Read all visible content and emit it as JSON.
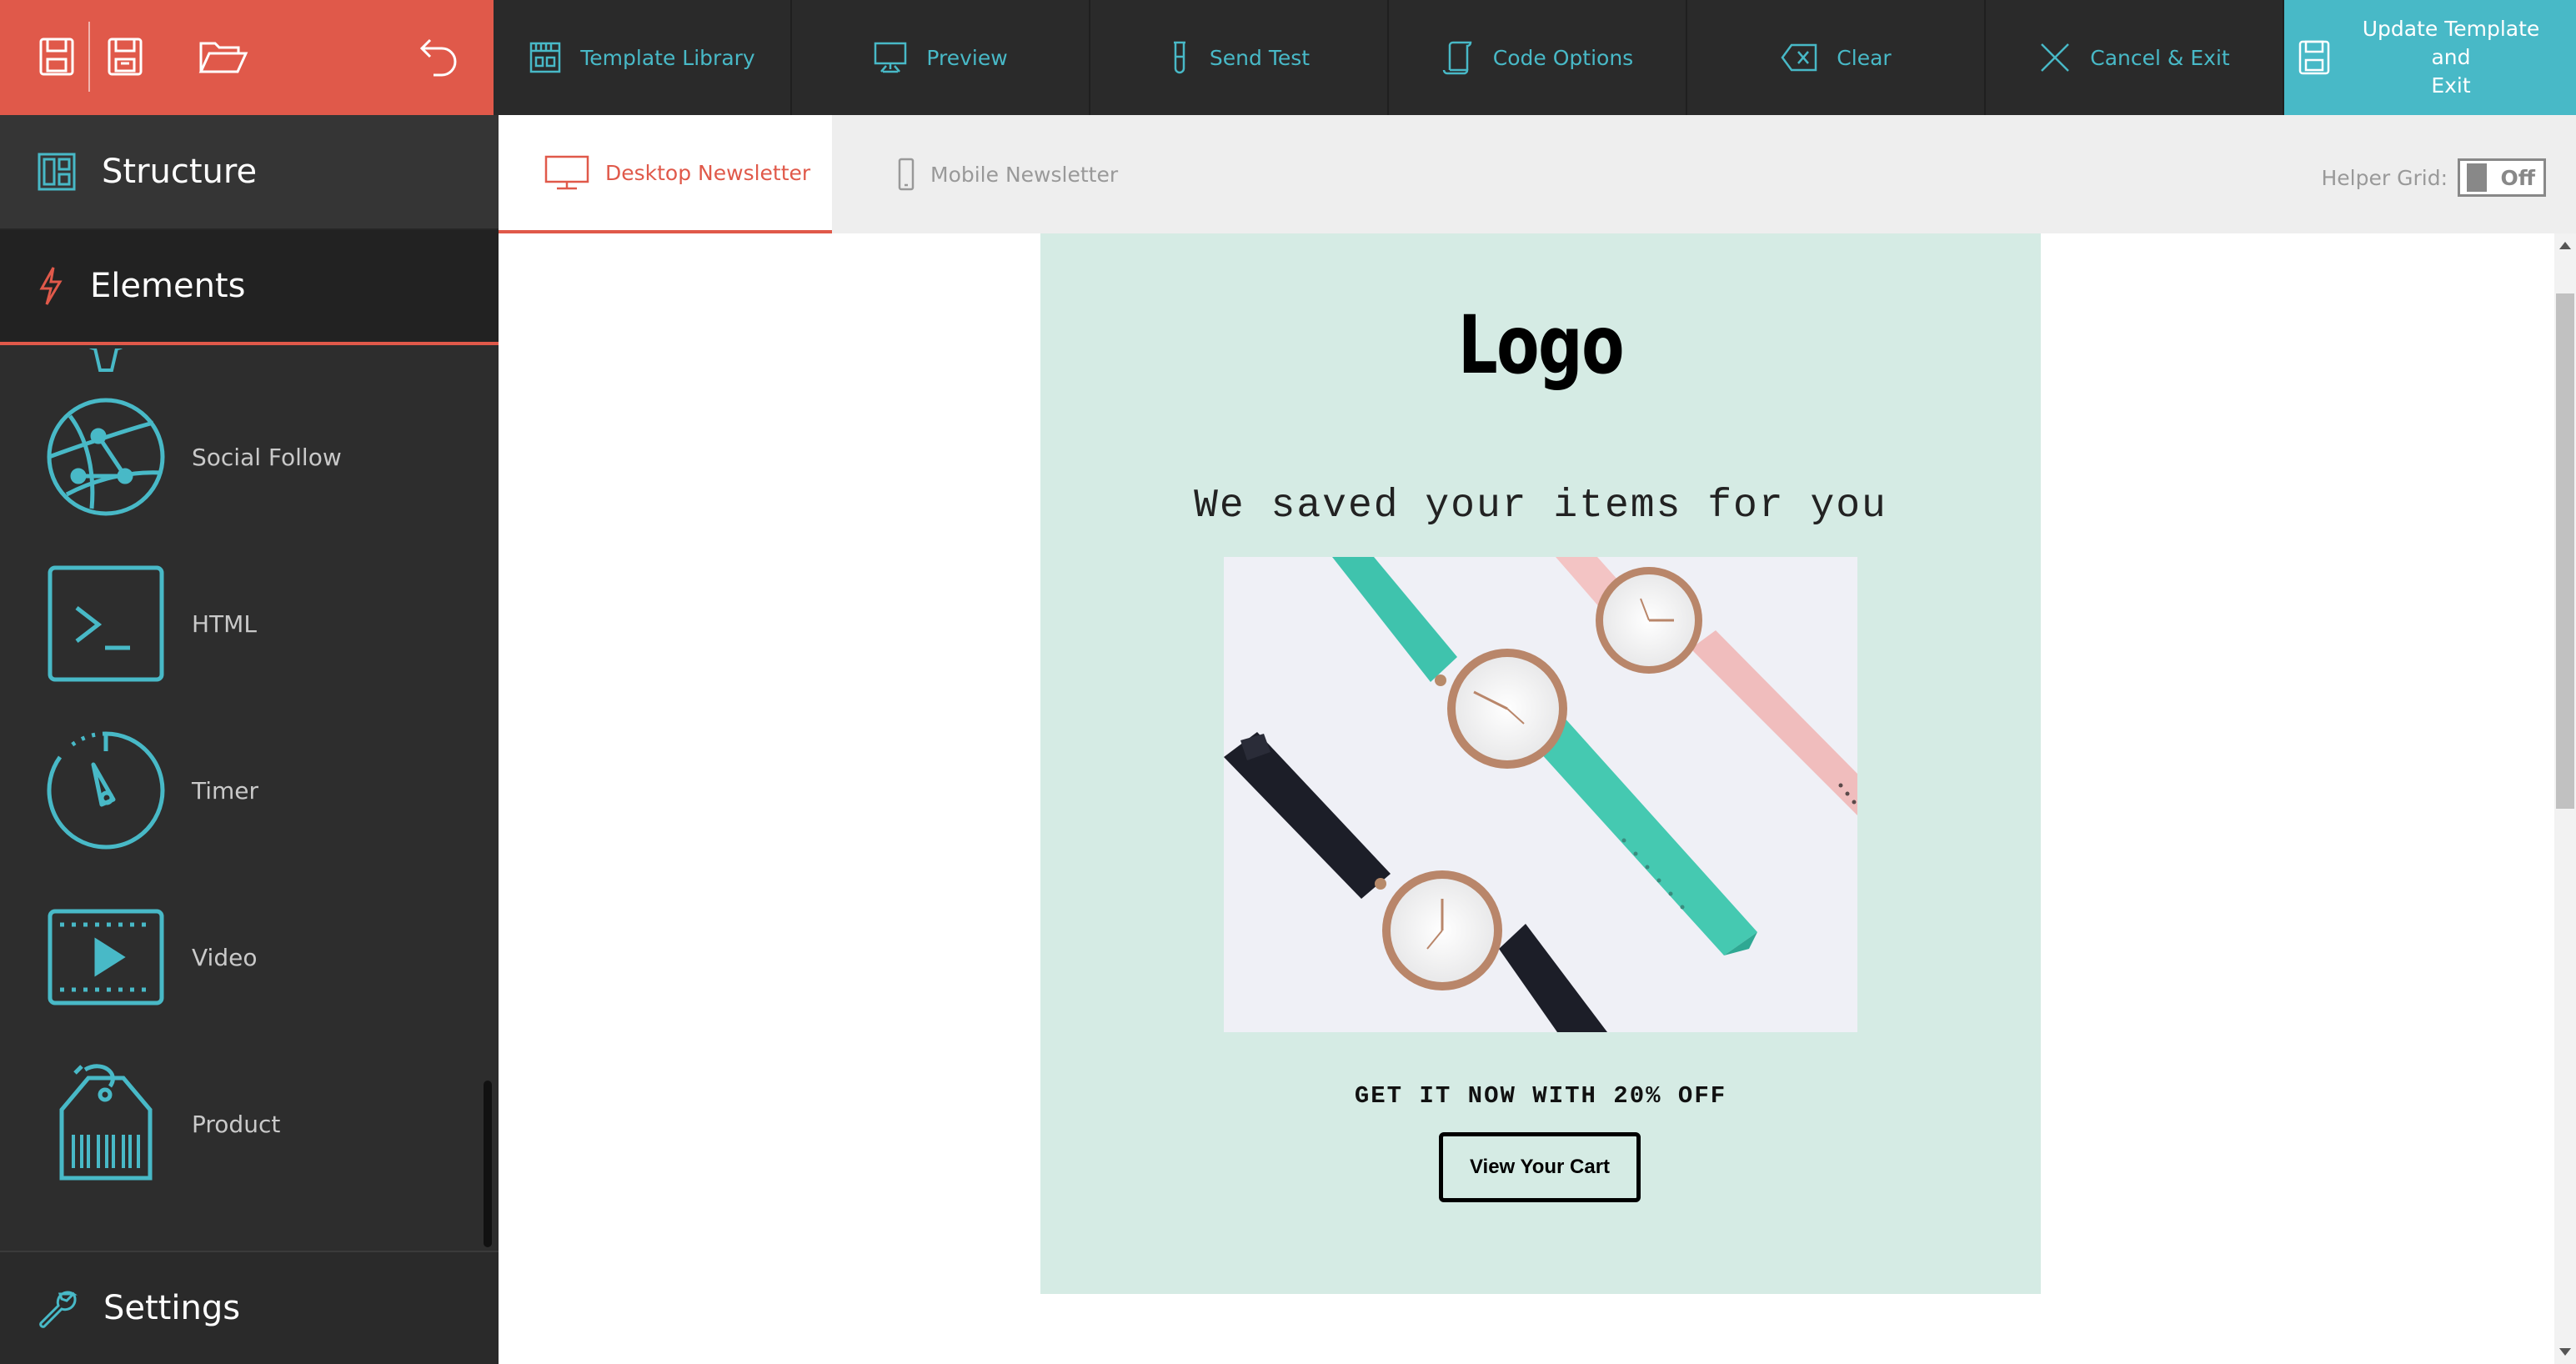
{
  "toolbar": {
    "template_library": "Template Library",
    "preview": "Preview",
    "send_test": "Send Test",
    "code_options": "Code Options",
    "clear": "Clear",
    "cancel_exit": "Cancel & Exit",
    "update_line1": "Update Template and",
    "update_line2": "Exit"
  },
  "sidebar": {
    "structure": "Structure",
    "elements": "Elements",
    "items": [
      {
        "label": "Social Follow",
        "icon": "social-follow-icon"
      },
      {
        "label": "HTML",
        "icon": "html-terminal-icon"
      },
      {
        "label": "Timer",
        "icon": "timer-icon"
      },
      {
        "label": "Video",
        "icon": "video-icon"
      },
      {
        "label": "Product",
        "icon": "product-tag-icon"
      }
    ],
    "settings": "Settings"
  },
  "tabs": {
    "desktop": "Desktop Newsletter",
    "mobile": "Mobile Newsletter"
  },
  "helper_grid": {
    "label": "Helper Grid:",
    "state": "Off"
  },
  "email": {
    "logo": "Logo",
    "headline": "We saved your items for you",
    "offer": "GET IT NOW WITH 20% OFF",
    "cta": "View Your Cart"
  },
  "colors": {
    "accent_red": "#e0594a",
    "accent_teal": "#48b9c7",
    "email_bg": "#d5ebe4",
    "sidebar_bg": "#2d2d2d",
    "topbar_bg": "#2a2a2a"
  }
}
